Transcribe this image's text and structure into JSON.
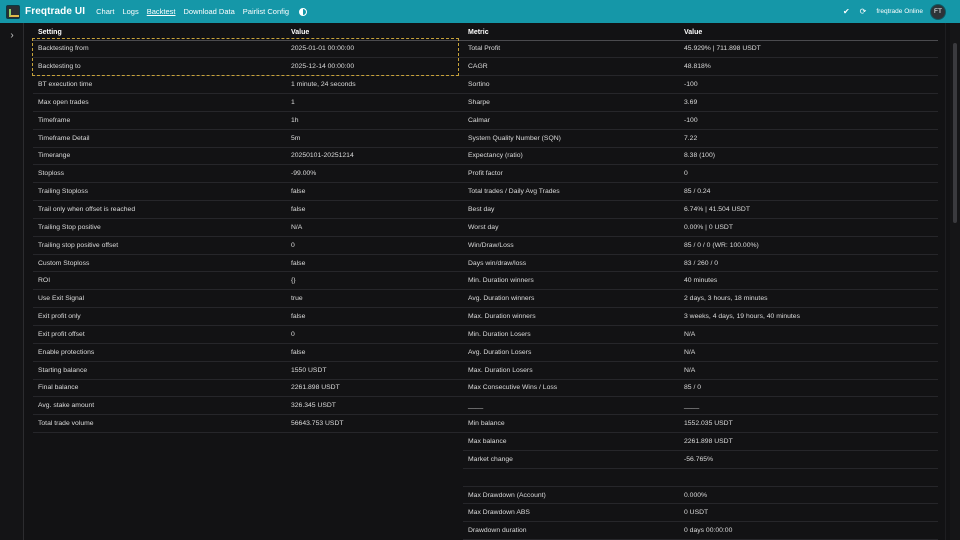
{
  "app": {
    "title": "Freqtrade UI",
    "nav": [
      "Chart",
      "Logs",
      "Backtest",
      "Download Data",
      "Pairlist Config"
    ],
    "active_nav": "Backtest",
    "bot_status": "freqtrade  Online",
    "avatar_initials": "FT",
    "check_icon": "✔",
    "refresh_icon": "⟳",
    "sidebar_toggle_icon": "›",
    "accent_color": "#1597a8",
    "highlight_color": "#c7a23a"
  },
  "settings_table": {
    "headers": [
      "Setting",
      "Value"
    ],
    "rows": [
      [
        "Backtesting from",
        "2025-01-01 00:00:00"
      ],
      [
        "Backtesting to",
        "2025-12-14 00:00:00"
      ],
      [
        "BT execution time",
        "1 minute, 24 seconds"
      ],
      [
        "Max open trades",
        "1"
      ],
      [
        "Timeframe",
        "1h"
      ],
      [
        "Timeframe Detail",
        "5m"
      ],
      [
        "Timerange",
        "20250101-20251214"
      ],
      [
        "Stoploss",
        "-99.00%"
      ],
      [
        "Trailing Stoploss",
        "false"
      ],
      [
        "Trail only when offset is reached",
        "false"
      ],
      [
        "Trailing Stop positive",
        "N/A"
      ],
      [
        "Trailing stop positive offset",
        "0"
      ],
      [
        "Custom Stoploss",
        "false"
      ],
      [
        "ROI",
        "{}"
      ],
      [
        "Use Exit Signal",
        "true"
      ],
      [
        "Exit profit only",
        "false"
      ],
      [
        "Exit profit offset",
        "0"
      ],
      [
        "Enable protections",
        "false"
      ],
      [
        "Starting balance",
        "1550 USDT"
      ],
      [
        "Final balance",
        "2261.898 USDT"
      ],
      [
        "Avg. stake amount",
        "326.345 USDT"
      ],
      [
        "Total trade volume",
        "56643.753 USDT"
      ]
    ]
  },
  "metrics_table": {
    "headers": [
      "Metric",
      "Value"
    ],
    "rows": [
      [
        "Total Profit",
        "45.929% | 711.898 USDT"
      ],
      [
        "CAGR",
        "48.818%"
      ],
      [
        "Sortino",
        "-100"
      ],
      [
        "Sharpe",
        "3.69"
      ],
      [
        "Calmar",
        "-100"
      ],
      [
        "System Quality Number (SQN)",
        "7.22"
      ],
      [
        "Expectancy (ratio)",
        "8.38 (100)"
      ],
      [
        "Profit factor",
        "0"
      ],
      [
        "Total trades / Daily Avg Trades",
        "85 / 0.24"
      ],
      [
        "Best day",
        "6.74% | 41.504 USDT"
      ],
      [
        "Worst day",
        "0.00% | 0 USDT"
      ],
      [
        "Win/Draw/Loss",
        "85 / 0 / 0 (WR: 100.00%)"
      ],
      [
        "Days win/draw/loss",
        "83 / 260 / 0"
      ],
      [
        "Min. Duration winners",
        "40 minutes"
      ],
      [
        "Avg. Duration winners",
        "2 days, 3 hours, 18 minutes"
      ],
      [
        "Max. Duration winners",
        "3 weeks, 4 days, 19 hours, 40 minutes"
      ],
      [
        "Min. Duration Losers",
        "N/A"
      ],
      [
        "Avg. Duration Losers",
        "N/A"
      ],
      [
        "Max. Duration Losers",
        "N/A"
      ],
      [
        "Max Consecutive Wins / Loss",
        "85 / 0"
      ],
      [
        "____",
        "____"
      ],
      [
        "Min balance",
        "1552.035 USDT"
      ],
      [
        "Max balance",
        "2261.898 USDT"
      ],
      [
        "Market change",
        "-56.765%"
      ],
      [
        "",
        ""
      ],
      [
        "Max Drawdown (Account)",
        "0.000%"
      ],
      [
        "Max Drawdown ABS",
        "0 USDT"
      ],
      [
        "Drawdown duration",
        "0 days 00:00:00"
      ]
    ]
  }
}
